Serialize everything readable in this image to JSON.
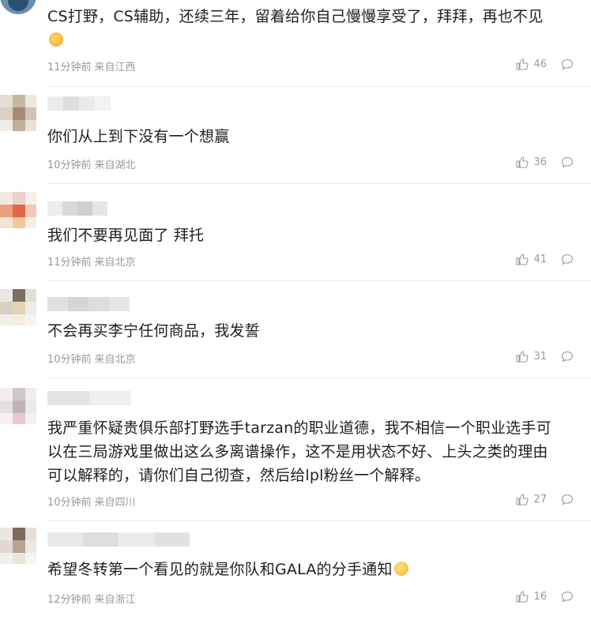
{
  "comments": [
    {
      "text": "CS打野，CS辅助，还续三年，留着给你自己慢慢享受了，拜拜，再也不见",
      "time": "11分钟前",
      "location": "来自江西",
      "likes": "46",
      "emoji": "face-icon"
    },
    {
      "text": "你们从上到下没有一个想赢",
      "time": "10分钟前",
      "location": "来自湖北",
      "likes": "36"
    },
    {
      "text": "我们不要再见面了 拜托",
      "time": "11分钟前",
      "location": "来自北京",
      "likes": "41"
    },
    {
      "text": "不会再买李宁任何商品，我发誓",
      "time": "10分钟前",
      "location": "来自北京",
      "likes": "31"
    },
    {
      "text_lines": [
        "我严重怀疑贵俱乐部打野选手tarzan的职业道德，我不相信一个职业选手可",
        "以在三局游戏里做出这么多离谱操作，这不是用状态不好、上头之类的理由",
        "可以解释的，请你们自己彻查，然后给lpl粉丝一个解释。"
      ],
      "time": "10分钟前",
      "location": "来自四川",
      "likes": "27"
    },
    {
      "text": "希望冬转第一个看见的就是你队和GALA的分手通知",
      "time": "12分钟前",
      "location": "来自浙江",
      "likes": "16",
      "emoji": "smile-icon"
    }
  ],
  "icons": {
    "like": "thumbs-up-icon",
    "reply": "comment-bubble-icon"
  },
  "colors": {
    "meta": "#999999",
    "divider": "#e8e8e8"
  }
}
